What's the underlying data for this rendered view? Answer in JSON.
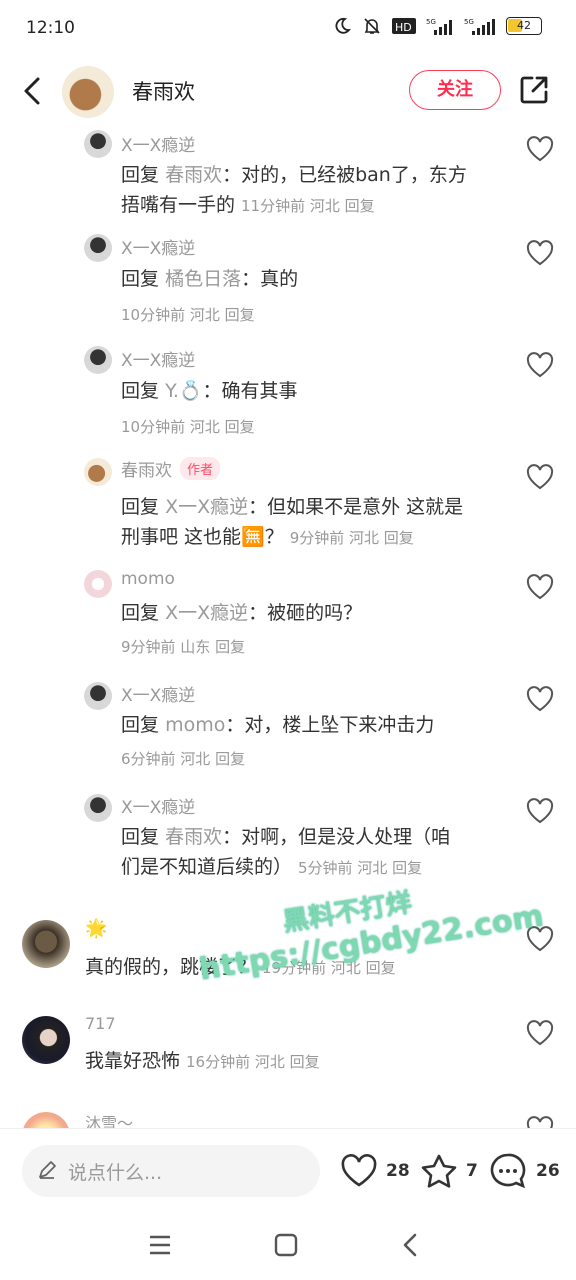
{
  "status_bar": {
    "time": "12:10",
    "battery": "42"
  },
  "header": {
    "name": "春雨欢",
    "follow_label": "关注"
  },
  "replies": [
    {
      "name": "X一X瘾逆",
      "reply_prefix": "回复",
      "target": "春雨欢",
      "text_line1": "：对的，已经被ban了，东方",
      "text_line2": "捂嘴有一手的",
      "meta": "11分钟前 河北 回复"
    },
    {
      "name": "X一X瘾逆",
      "reply_prefix": "回复",
      "target": "橘色日落",
      "text": "：真的",
      "meta": "10分钟前 河北 回复"
    },
    {
      "name": "X一X瘾逆",
      "reply_prefix": "回复",
      "target": "Y.💍",
      "text": "：确有其事",
      "meta": "10分钟前 河北 回复"
    },
    {
      "name": "春雨欢",
      "author_tag": "作者",
      "reply_prefix": "回复",
      "target": "X一X瘾逆",
      "text_line1": "：但如果不是意外 这就是",
      "text_line2": "刑事吧 这也能🈚？",
      "meta": "9分钟前 河北 回复"
    },
    {
      "name": "momo",
      "reply_prefix": "回复",
      "target": "X一X瘾逆",
      "text": "：被砸的吗？",
      "meta": "9分钟前 山东 回复"
    },
    {
      "name": "X一X瘾逆",
      "reply_prefix": "回复",
      "target": "momo",
      "text": "：对，楼上坠下来冲击力",
      "meta": "6分钟前 河北 回复"
    },
    {
      "name": "X一X瘾逆",
      "reply_prefix": "回复",
      "target": "春雨欢",
      "text_line1": "：对啊，但是没人处理（咱",
      "text_line2": "们是不知道后续的）",
      "meta": "5分钟前 河北 回复"
    }
  ],
  "comments": [
    {
      "name": "🌟",
      "text": "真的假的，跳楼了？",
      "meta": "19分钟前 河北 回复"
    },
    {
      "name": "717",
      "text": "我靠好恐怖",
      "meta": "16分钟前 河北 回复"
    },
    {
      "name": "沐雪～"
    }
  ],
  "watermark": {
    "line1": "黑料不打烊",
    "line2": "https://cgbdy22.com"
  },
  "bottom_bar": {
    "placeholder": "说点什么...",
    "likes": "28",
    "stars": "7",
    "comments": "26"
  },
  "colors": {
    "accent": "#ff2d4f",
    "meta_gray": "#999999"
  }
}
